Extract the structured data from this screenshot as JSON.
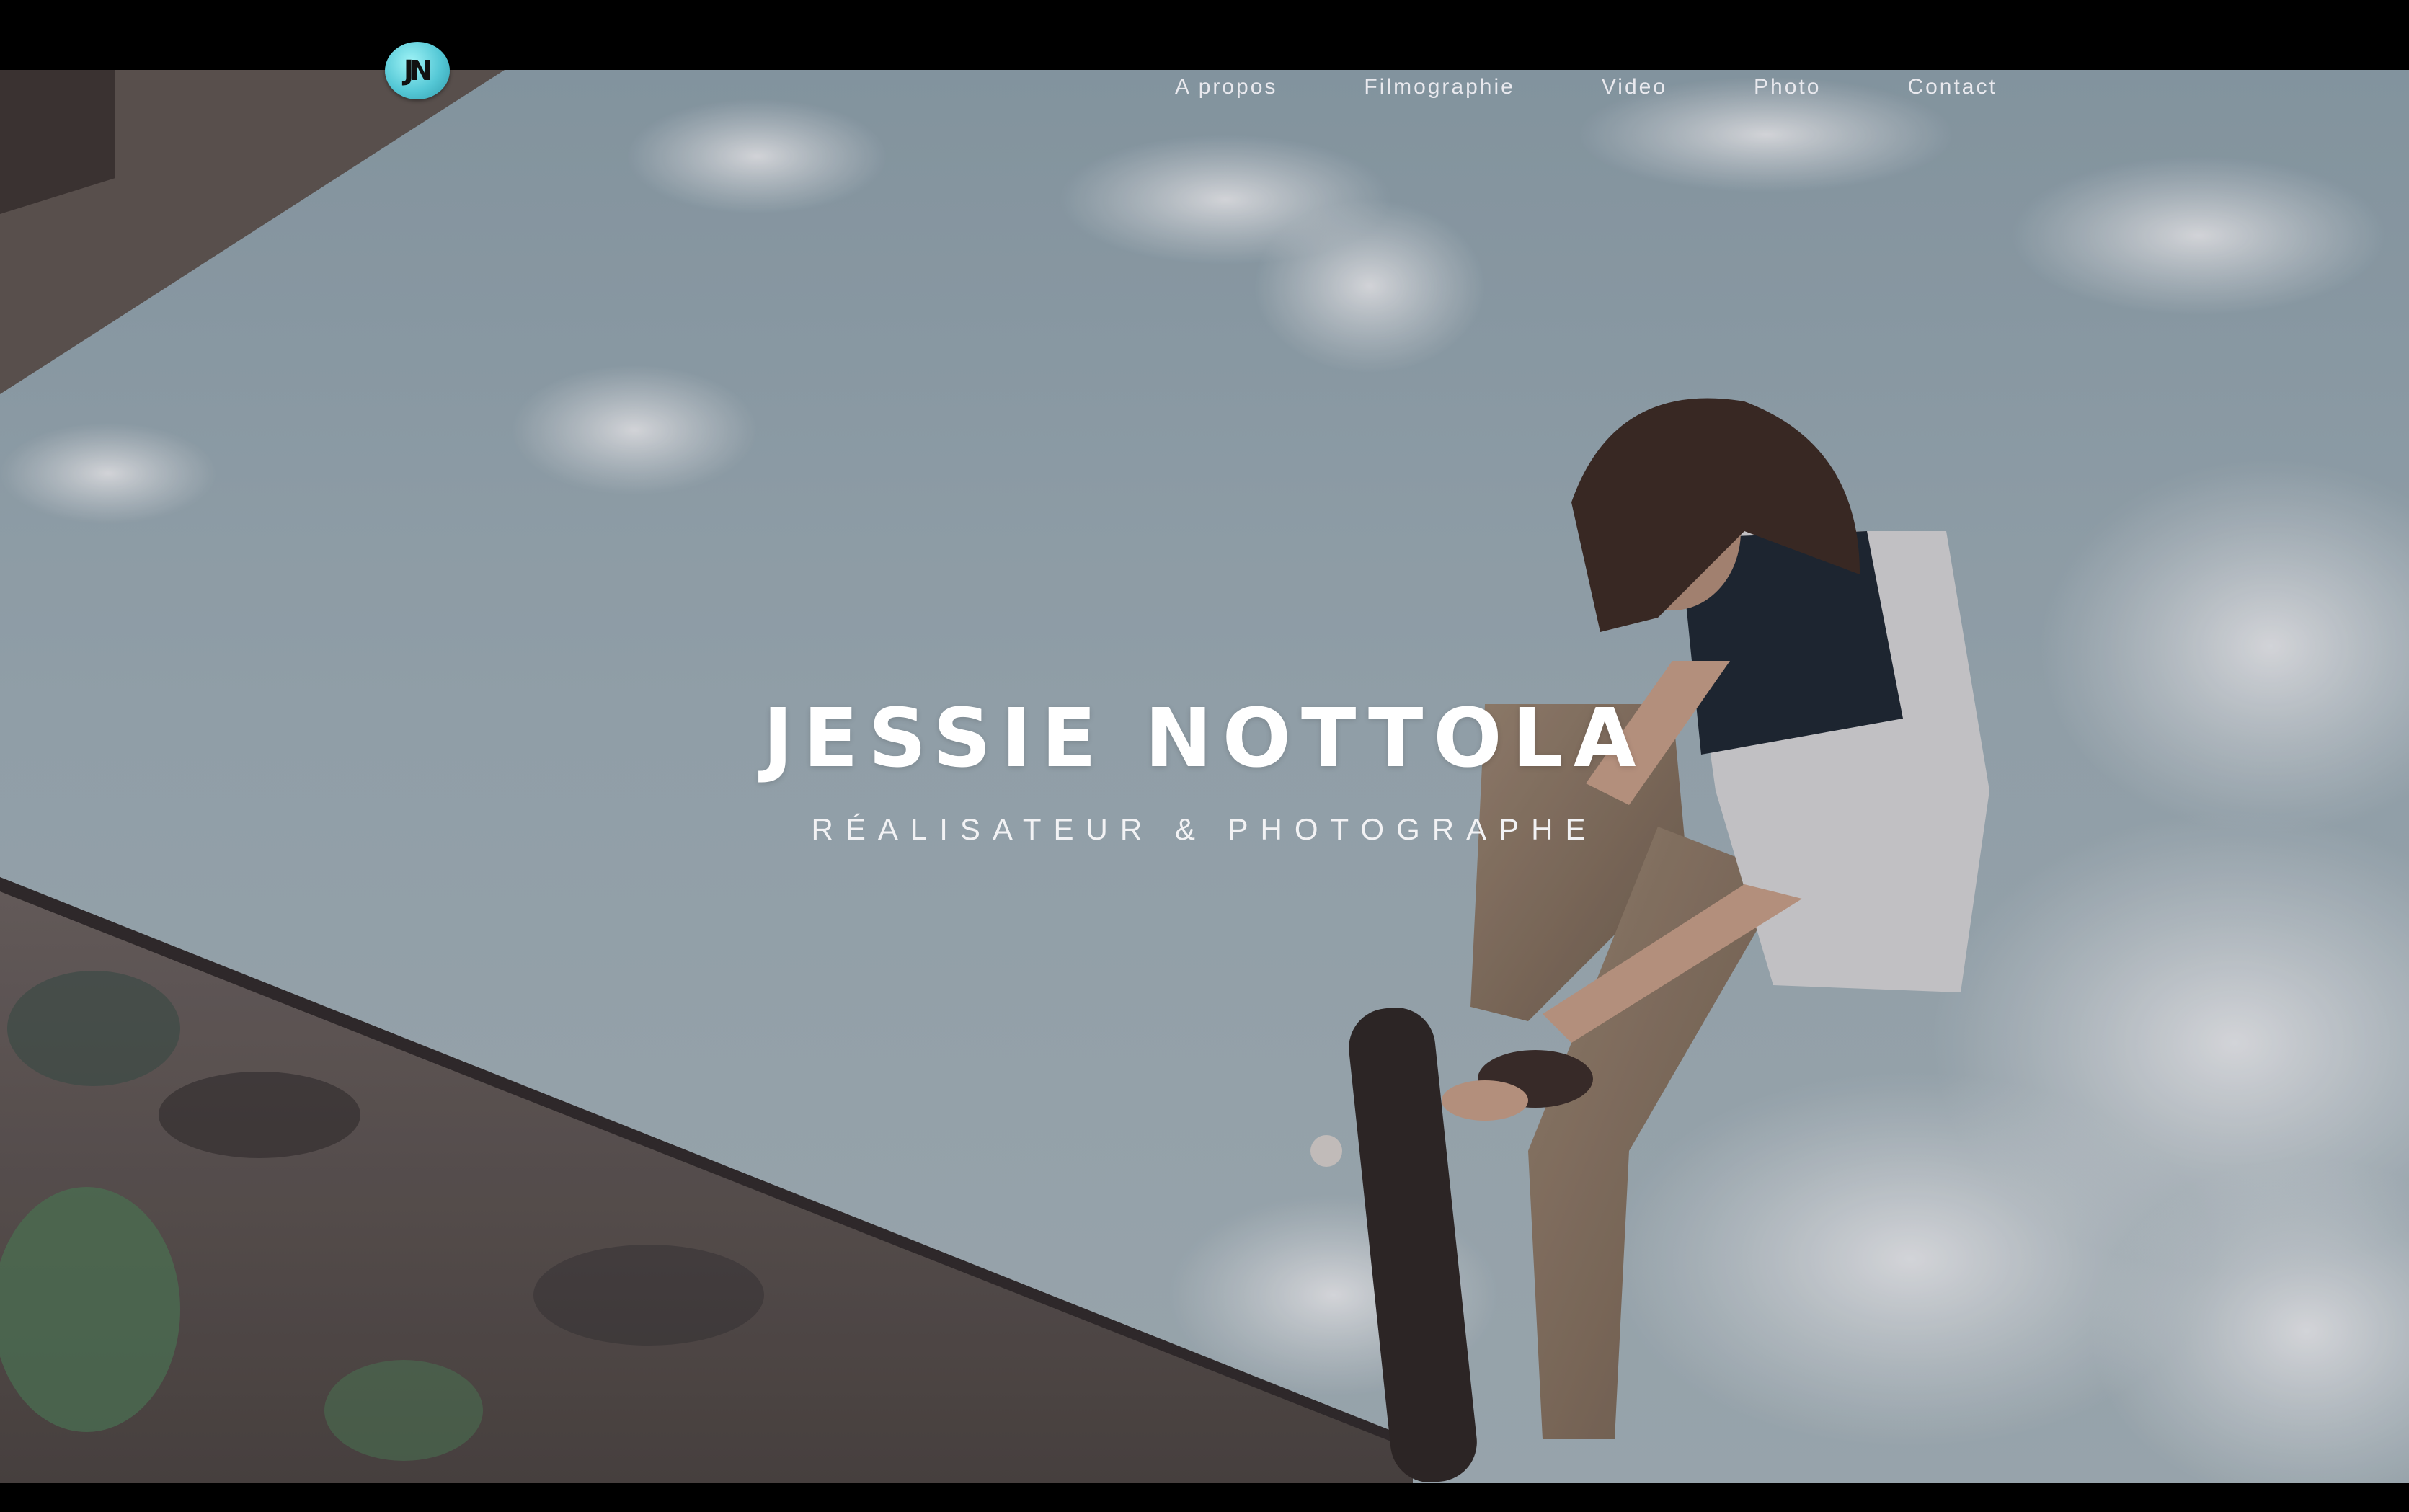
{
  "brand": {
    "logo_text": "JN",
    "logo_color": "#5fd0dc"
  },
  "nav": {
    "items": [
      {
        "label": "A propos"
      },
      {
        "label": "Filmographie"
      },
      {
        "label": "Video"
      },
      {
        "label": "Photo"
      },
      {
        "label": "Contact"
      }
    ]
  },
  "hero": {
    "title": "JESSIE NOTTOLA",
    "subtitle": "RÉALISATEUR & PHOTOGRAPHE",
    "background_image": "skateboarder-low-angle-sky"
  },
  "colors": {
    "text": "#ffffff",
    "nav_text": "#e9e9ee",
    "frame": "#000000",
    "sky": "#9fb0b8"
  }
}
